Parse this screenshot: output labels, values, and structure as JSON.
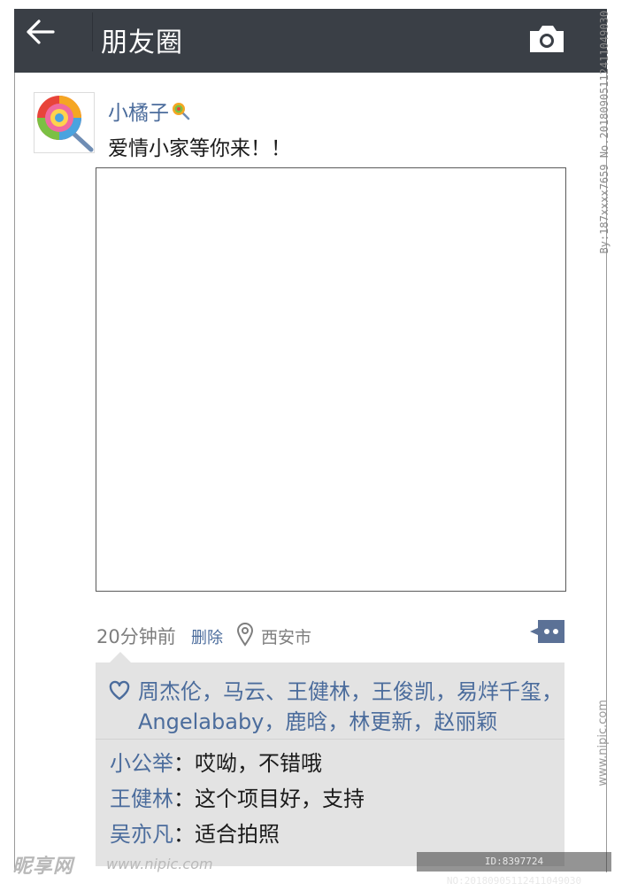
{
  "header": {
    "title": "朋友圈",
    "back_icon": "arrow-left-icon",
    "camera_icon": "camera-icon"
  },
  "post": {
    "username": "小橘子",
    "text": "爱情小家等你来！！",
    "avatar_icon": "lollipop-avatar-icon",
    "time": "20分钟前",
    "delete_label": "删除",
    "location": "西安市"
  },
  "likes": {
    "icon": "heart-icon",
    "names": "周杰伦，马云、王健林，王俊凯，易烊千玺，Angelababy，鹿晗，林更新，赵丽颖"
  },
  "comments": [
    {
      "name": "小公举",
      "text": "哎呦，不错哦"
    },
    {
      "name": "王健林",
      "text": "这个项目好，支持"
    },
    {
      "name": "吴亦凡",
      "text": "适合拍照"
    }
  ],
  "comment_separator": "：",
  "watermark": {
    "side_text": "By:187xxxx7659 No.20180905112411049030",
    "side_text2": "www.nipic.com",
    "logo": "昵享网",
    "url": "www.nipic.com",
    "id_text": "ID:8397724 NO:20180905112411049030"
  },
  "colors": {
    "header_bg": "#3a3f46",
    "link_blue": "#4b6c9c",
    "interact_bg": "#e3e3e3"
  }
}
